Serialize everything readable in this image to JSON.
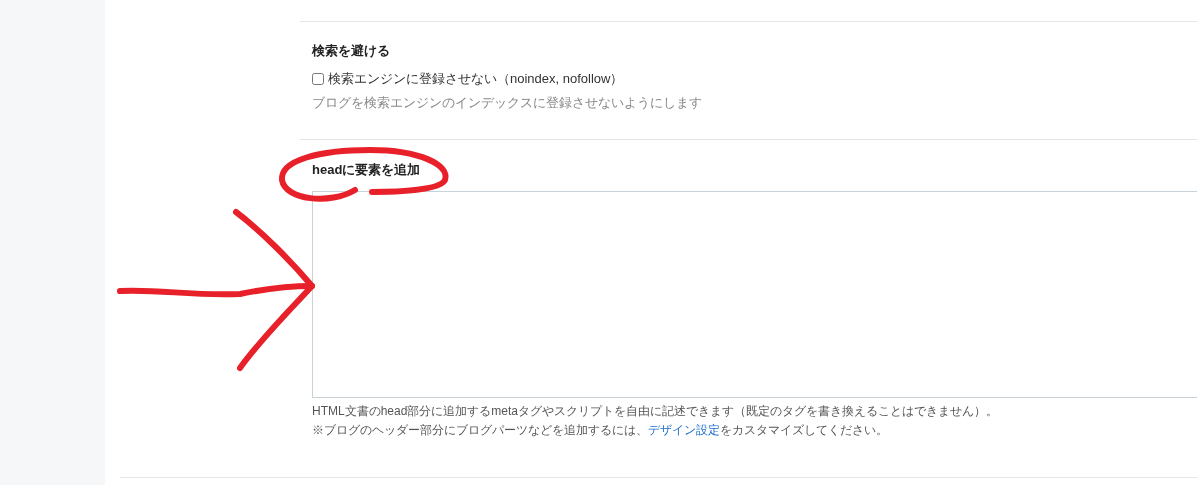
{
  "noindex_section": {
    "heading": "検索を避ける",
    "checkbox": {
      "label": "検索エンジンに登録させない（noindex, nofollow）",
      "checked": false
    },
    "description": "ブログを検索エンジンのインデックスに登録させないようにします"
  },
  "head_section": {
    "heading": "headに要素を追加",
    "help": "HTML文書のhead部分に追加するmetaタグやスクリプトを自由に記述できます（既定のタグを書き換えることはできません）。",
    "note_before": "※ブログのヘッダー部分にブログパーツなどを追加するには、",
    "note_link": "デザイン設定",
    "note_after": "をカスタマイズしてください。"
  }
}
